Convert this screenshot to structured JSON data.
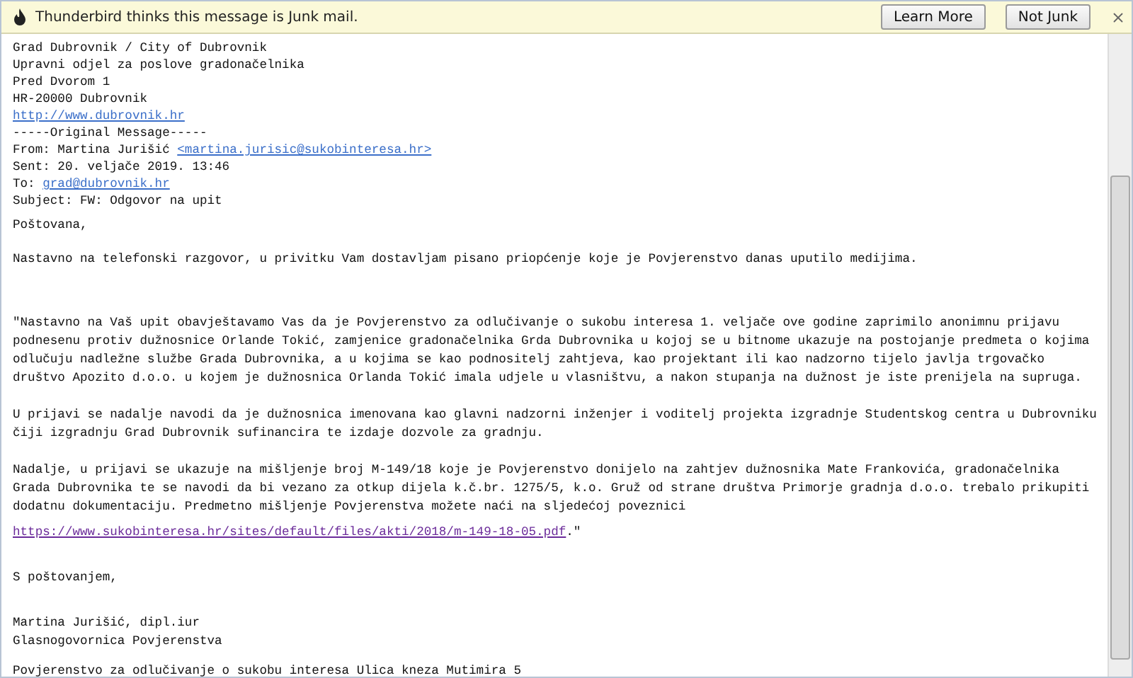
{
  "junk_bar": {
    "message": "Thunderbird thinks this message is Junk mail.",
    "buttons": [
      "Learn More",
      "Not Junk"
    ]
  },
  "header_lines": [
    {
      "text": "Grad Dubrovnik / City of Dubrovnik"
    },
    {
      "text": "Upravni odjel za poslove gradonačelnika"
    },
    {
      "text": "Pred Dvorom 1"
    },
    {
      "text": "HR-20000 Dubrovnik"
    },
    {
      "link": "http://www.dubrovnik.hr"
    },
    {
      "text": "-----Original Message-----"
    },
    {
      "text": "From: Martina Jurišić",
      "link": "<martina.jurisic@sukobinteresa.hr>"
    },
    {
      "text": "Sent: 20. veljače 2019. 13:46"
    },
    {
      "text": "To:",
      "link": "grad@dubrovnik.hr"
    },
    {
      "text": "Subject: FW: Odgovor na upit"
    }
  ],
  "paragraphs": [
    {
      "lines": [
        "Poštovana,"
      ]
    },
    {
      "lines": [
        "Nastavno na telefonski razgovor, u privitku Vam dostavljam pisano priopćenje koje je Povjerenstvo danas uputilo medijima."
      ]
    },
    {
      "lines": [
        "\"Nastavno na Vaš upit obavještavamo Vas da je Povjerenstvo za odlučivanje o sukobu interesa 1. veljače ove godine zaprimilo anonimnu prijavu",
        "podnesenu protiv dužnosnice Orlande Tokić, zamjenice gradonačelnika Grda Dubrovnika u kojoj se u bitnome ukazuje na postojanje predmeta o kojima",
        "odlučuju nadležne službe Grada Dubrovnika, a u kojima se kao podnositelj zahtjeva, kao projektant ili kao nadzorno tijelo javlja trgovačko",
        "društvo Apozito d.o.o. u kojem je dužnosnica Orlanda Tokić imala udjele u vlasništvu, a nakon stupanja na dužnost je iste prenijela na supruga."
      ]
    },
    {
      "lines": [
        "U prijavi se nadalje navodi da je dužnosnica imenovana kao glavni nadzorni inženjer i voditelj projekta izgradnje Studentskog centra u Dubrovniku",
        "čiji izgradnju Grad Dubrovnik sufinancira te izdaje dozvole za gradnju."
      ]
    },
    {
      "lines": [
        "Nadalje, u prijavi se ukazuje na mišljenje broj M-149/18 koje je Povjerenstvo donijelo na zahtjev dužnosnika Mate Frankovića, gradonačelnika",
        "Grada Dubrovnika te se navodi da bi vezano za otkup dijela k.č.br. 1275/5, k.o. Gruž od strane društva Primorje gradnja d.o.o. trebalo prikupiti",
        "dodatnu dokumentaciju. Predmetno mišljenje Povjerenstva možete naći na sljedećoj poveznici"
      ]
    },
    {
      "link": "https://www.sukobinteresa.hr/sites/default/files/akti/2018/m-149-18-05.pdf",
      "lines": [
        ".\""
      ]
    },
    {
      "lines": [
        "S poštovanjem,"
      ]
    },
    {
      "lines": [
        "Martina Jurišić, dipl.iur",
        "Glasnogovornica Povjerenstva"
      ]
    },
    {
      "lines": [
        "Povjerenstvo za odlučivanje o sukobu interesa Ulica kneza Mutimira 5"
      ]
    }
  ]
}
